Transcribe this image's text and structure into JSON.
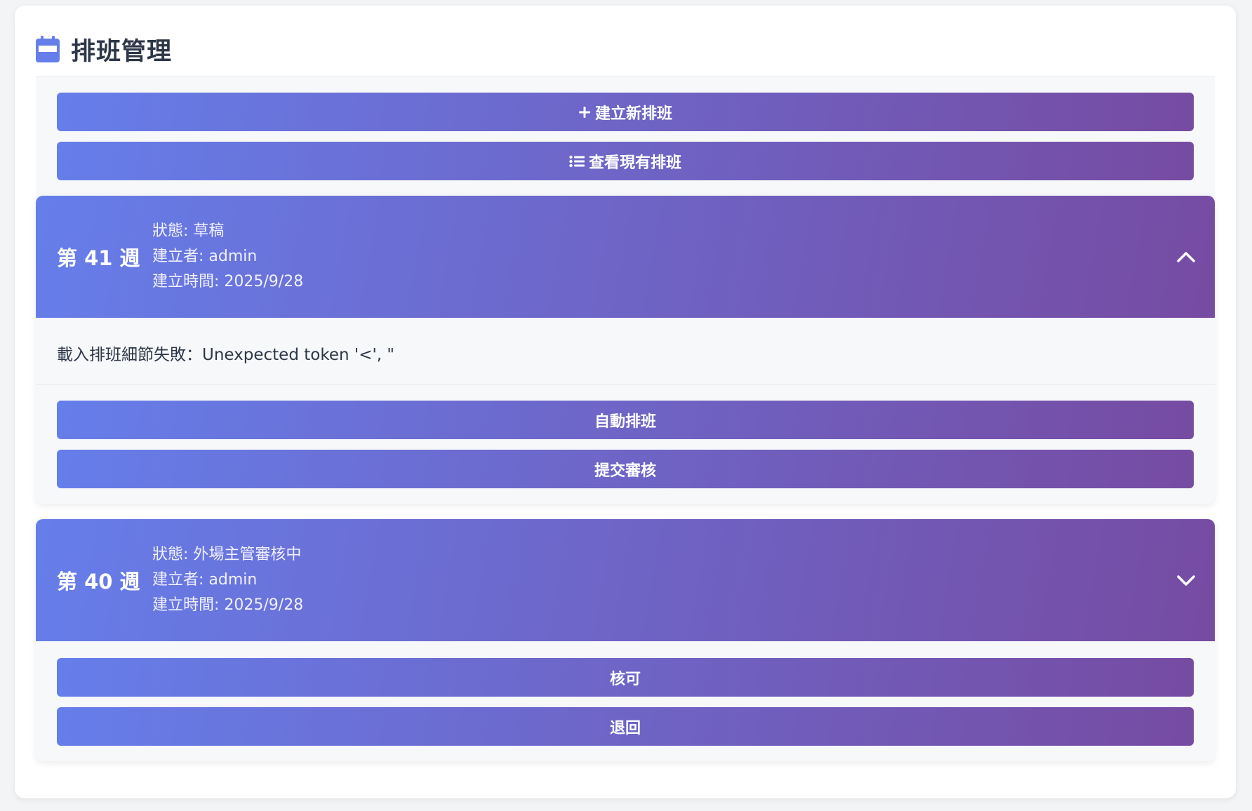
{
  "page": {
    "title": "排班管理",
    "title_icon": "calendar-icon"
  },
  "toolbar": {
    "create_label": "建立新排班",
    "create_icon": "plus-icon",
    "view_label": "查看現有排班",
    "view_icon": "list-icon"
  },
  "schedules": [
    {
      "week_label": "第 41 週",
      "status": "狀態: 草稿",
      "creator": "建立者: admin",
      "created_at": "建立時間: 2025/9/28",
      "expanded": true,
      "chevron_icon": "chevron-up-icon",
      "error_message": "載入排班細節失敗：Unexpected token '<', \"",
      "actions": [
        "自動排班",
        "提交審核"
      ]
    },
    {
      "week_label": "第 40 週",
      "status": "狀態: 外場主管審核中",
      "creator": "建立者: admin",
      "created_at": "建立時間: 2025/9/28",
      "expanded": false,
      "chevron_icon": "chevron-down-icon",
      "actions": [
        "核可",
        "退回"
      ]
    }
  ],
  "colors": {
    "gradient_start": "#667eea",
    "gradient_end": "#764ba2",
    "background": "#f3f4f6",
    "card": "#ffffff"
  }
}
